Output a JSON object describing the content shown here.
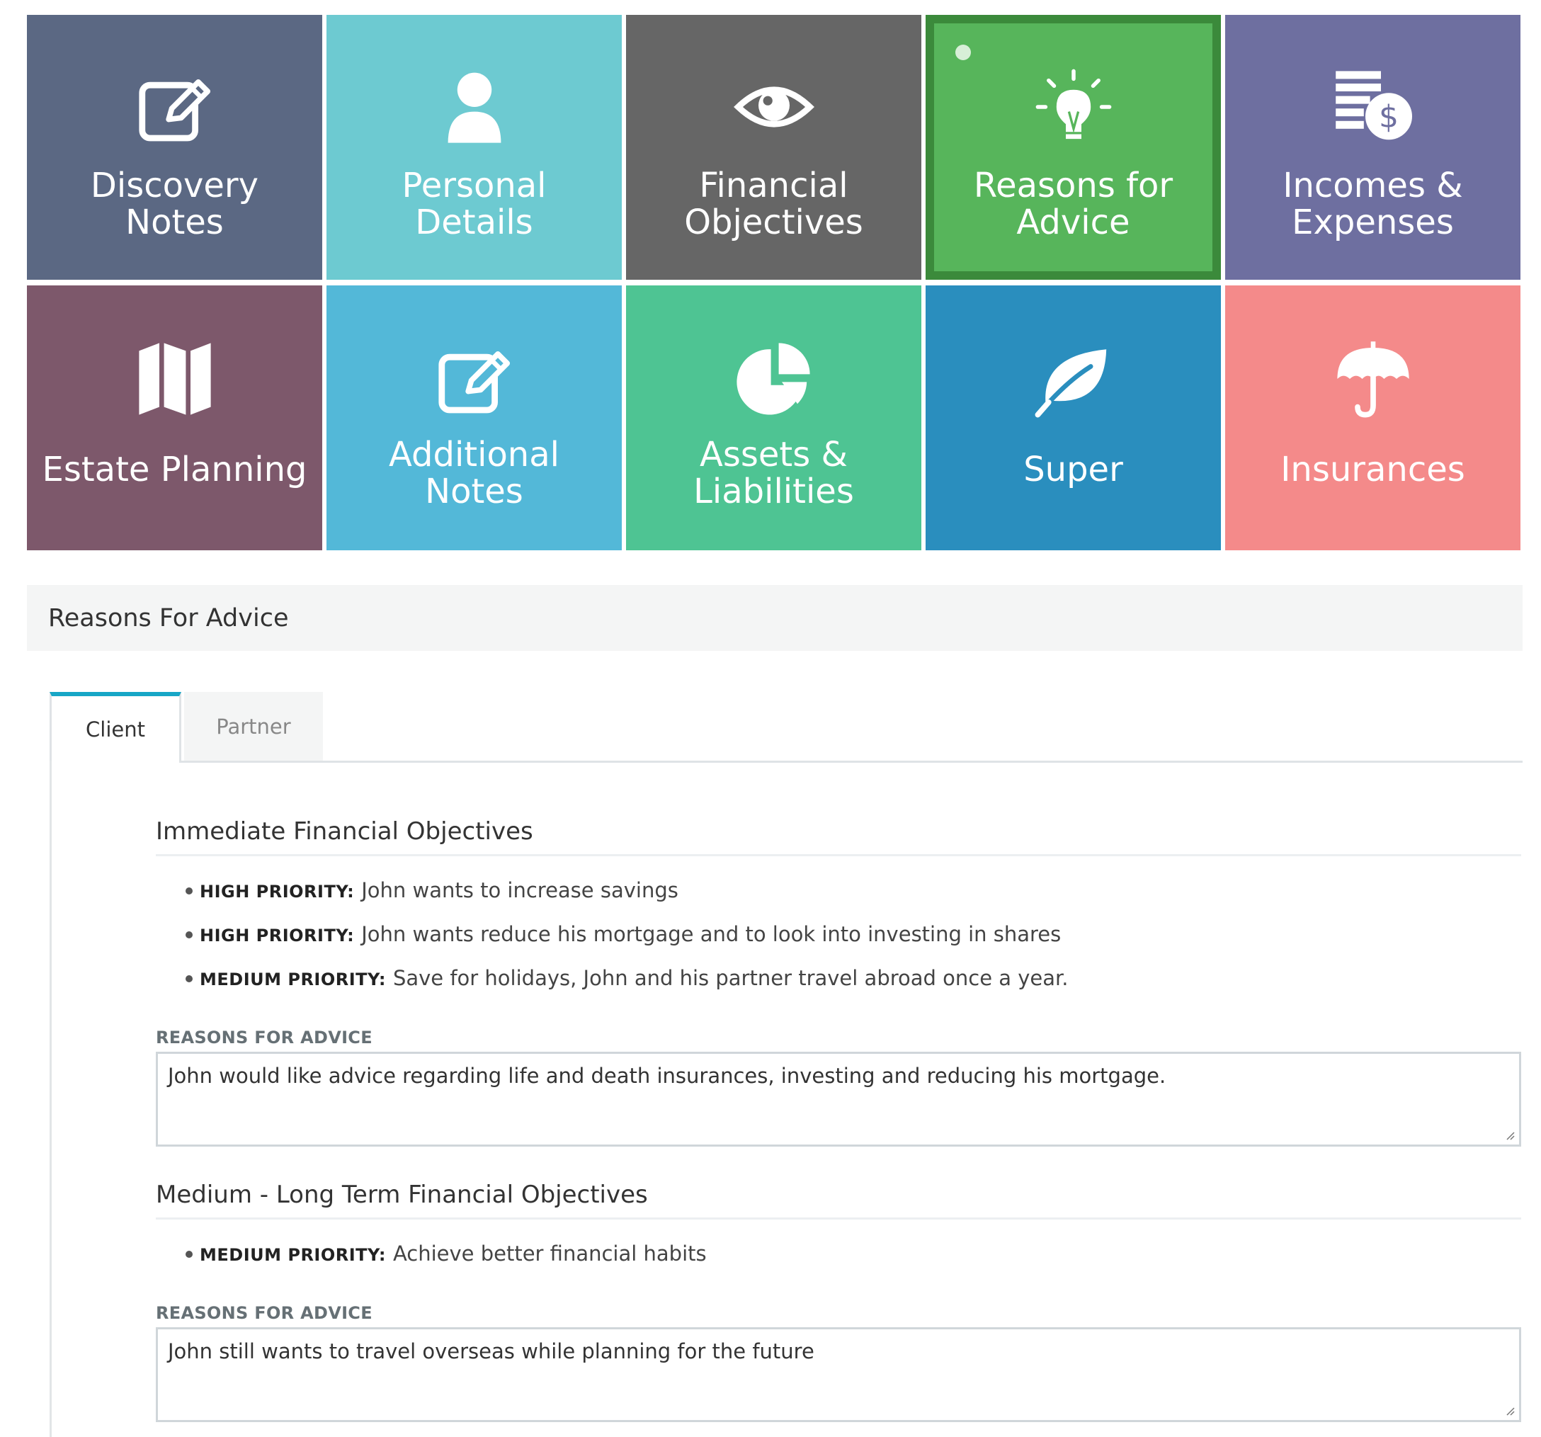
{
  "tiles": [
    {
      "key": "discovery",
      "label": [
        "Discovery",
        "Notes"
      ],
      "icon": "edit-icon",
      "color": "#5b6883"
    },
    {
      "key": "personal",
      "label": [
        "Personal",
        "Details"
      ],
      "icon": "user-icon",
      "color": "#6dcad1"
    },
    {
      "key": "financial",
      "label": [
        "Financial",
        "Objectives"
      ],
      "icon": "eye-icon",
      "color": "#666666"
    },
    {
      "key": "reasons",
      "label": [
        "Reasons for",
        "Advice"
      ],
      "icon": "lightbulb-icon",
      "color": "#57b55b",
      "active": true
    },
    {
      "key": "incomes",
      "label": [
        "Incomes &",
        "Expenses"
      ],
      "icon": "coins-dollar-icon",
      "color": "#6e6fa0"
    },
    {
      "key": "estate",
      "label": [
        "Estate Planning"
      ],
      "icon": "map-icon",
      "color": "#7d586b"
    },
    {
      "key": "additional",
      "label": [
        "Additional",
        "Notes"
      ],
      "icon": "edit-icon",
      "color": "#53b8d8"
    },
    {
      "key": "assets",
      "label": [
        "Assets &",
        "Liabilities"
      ],
      "icon": "pie-chart-icon",
      "color": "#4ec493"
    },
    {
      "key": "super",
      "label": [
        "Super"
      ],
      "icon": "leaf-icon",
      "color": "#2a8ebe"
    },
    {
      "key": "insurances",
      "label": [
        "Insurances"
      ],
      "icon": "umbrella-icon",
      "color": "#f48a8a"
    }
  ],
  "section_title": "Reasons For Advice",
  "tabs": {
    "client": "Client",
    "partner": "Partner"
  },
  "immediate": {
    "heading": "Immediate Financial Objectives",
    "items": [
      {
        "priority": "HIGH PRIORITY:",
        "text": "John wants to increase savings"
      },
      {
        "priority": "HIGH PRIORITY:",
        "text": "John wants reduce his mortgage and to look into investing in shares"
      },
      {
        "priority": "MEDIUM PRIORITY:",
        "text": "Save for holidays, John and his partner travel abroad once a year."
      }
    ],
    "reasons_label": "REASONS FOR ADVICE",
    "reasons_value": "John would like advice regarding life and death insurances, investing and reducing his mortgage."
  },
  "longterm": {
    "heading": "Medium - Long Term Financial Objectives",
    "items": [
      {
        "priority": "MEDIUM PRIORITY:",
        "text": "Achieve better financial habits"
      }
    ],
    "reasons_label": "REASONS FOR ADVICE",
    "reasons_value": "John still wants to travel overseas while planning for the future"
  }
}
